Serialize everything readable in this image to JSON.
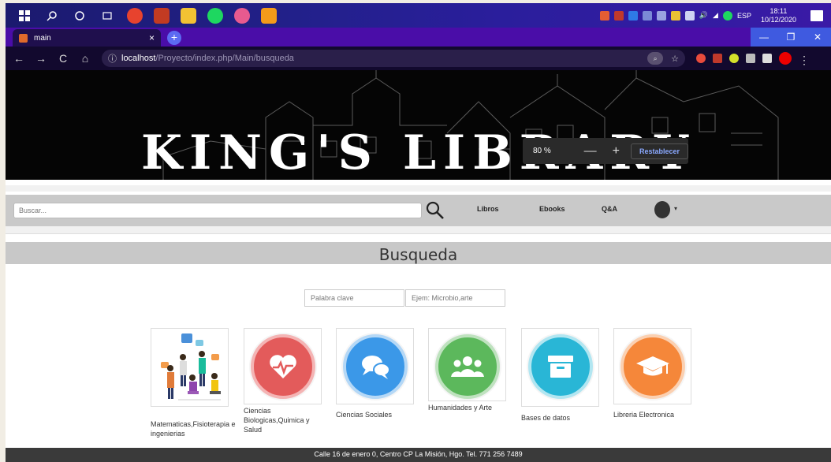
{
  "taskbar": {
    "lang": "ESP",
    "time": "18:11",
    "date": "10/12/2020"
  },
  "browser": {
    "tab_title": "main",
    "tab_close": "×",
    "new_tab": "+",
    "url_host": "localhost",
    "url_path": "/Proyecto/index.php/Main/busqueda"
  },
  "zoom_popup": {
    "level": "80 %",
    "minus": "—",
    "plus": "+",
    "reset_label": "Restablecer"
  },
  "banner": {
    "title": "KING'S LIBRARY"
  },
  "navbar": {
    "search_placeholder": "Buscar...",
    "links": [
      "Libros",
      "Ebooks",
      "Q&A"
    ],
    "caret": "▾"
  },
  "main": {
    "heading": "Busqueda",
    "keyword_placeholder": "Palabra clave",
    "example_placeholder": "Ejem: Microbio,arte",
    "categories": [
      {
        "label": "Matematicas,Fisioterapia e ingenierias",
        "icon": "people-illustration"
      },
      {
        "label": "Ciencias Biologicas,Quimica y Salud",
        "icon": "heartbeat-icon",
        "color": "#e35b5b"
      },
      {
        "label": "Ciencias Sociales",
        "icon": "chat-bubbles-icon",
        "color": "#3b98e8"
      },
      {
        "label": "Humanidades y Arte",
        "icon": "group-icon",
        "color": "#5cb85c"
      },
      {
        "label": "Bases de datos",
        "icon": "archive-box-icon",
        "color": "#29b6d6"
      },
      {
        "label": "Libreria Electronica",
        "icon": "graduation-cap-icon",
        "color": "#f5873a"
      }
    ]
  },
  "footer": {
    "text": "Calle 16 de enero 0, Centro CP La Misión, Hgo. Tel. 771 256 7489"
  }
}
